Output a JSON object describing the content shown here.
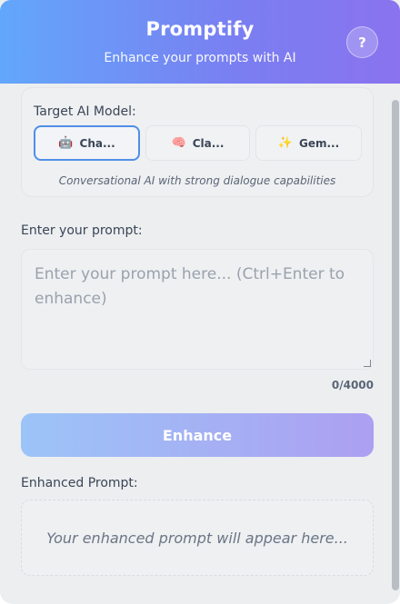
{
  "header": {
    "title": "Promptify",
    "subtitle": "Enhance your prompts with AI",
    "help_label": "?"
  },
  "model_section": {
    "label": "Target AI Model:",
    "models": [
      {
        "icon": "🤖",
        "label": "Cha...",
        "selected": true
      },
      {
        "icon": "🧠",
        "label": "Cla...",
        "selected": false
      },
      {
        "icon": "✨",
        "label": "Gem...",
        "selected": false
      }
    ],
    "description": "Conversational AI with strong dialogue capabilities"
  },
  "prompt": {
    "label": "Enter your prompt:",
    "placeholder": "Enter your prompt here... (Ctrl+Enter to enhance)",
    "value": "",
    "counter": "0/4000"
  },
  "enhance_button": {
    "label": "Enhance"
  },
  "output": {
    "label": "Enhanced Prompt:",
    "placeholder": "Your enhanced prompt will appear here..."
  },
  "colors": {
    "header_gradient_start": "#62a7fb",
    "header_gradient_end": "#8a73ef",
    "selected_border": "#4f8fe8"
  }
}
